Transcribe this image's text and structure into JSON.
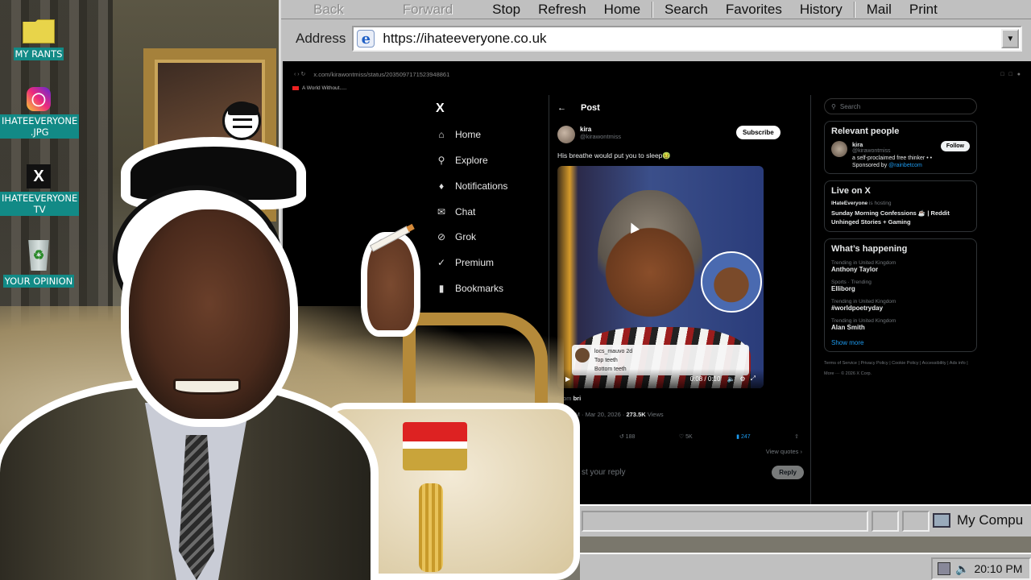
{
  "desktop": {
    "icons": [
      {
        "label": "MY RANTS",
        "icon": "folder-icon"
      },
      {
        "label": "IHATEEVERYONE .JPG",
        "icon": "instagram-icon"
      },
      {
        "label": "IHATEEVERYONE TV",
        "icon": "x-icon"
      },
      {
        "label": "YOUR OPINION",
        "icon": "recycle-bin-icon"
      }
    ]
  },
  "browser": {
    "toolbar": {
      "back": "Back",
      "forward": "Forward",
      "stop": "Stop",
      "refresh": "Refresh",
      "home": "Home",
      "search": "Search",
      "favorites": "Favorites",
      "history": "History",
      "mail": "Mail",
      "print": "Print"
    },
    "address_label": "Address",
    "address_value": "https://ihateeveryone.co.uk",
    "status": {
      "my_computer": "My Compu"
    }
  },
  "embedded": {
    "url": "x.com/kirawontmiss/status/2035097171523948861",
    "tab_hint": "A World Without.....",
    "nav": [
      {
        "label": "Home",
        "icon": "home-icon"
      },
      {
        "label": "Explore",
        "icon": "search-icon"
      },
      {
        "label": "Notifications",
        "icon": "bell-icon"
      },
      {
        "label": "Chat",
        "icon": "mail-icon"
      },
      {
        "label": "Grok",
        "icon": "grok-icon"
      },
      {
        "label": "Premium",
        "icon": "premium-icon"
      },
      {
        "label": "Bookmarks",
        "icon": "bookmark-icon"
      }
    ],
    "post": {
      "header": "Post",
      "author_name": "kira",
      "author_handle": "@kirawontmiss",
      "subscribe": "Subscribe",
      "text": "His breathe would put you to sleep🤢",
      "reply_user": "locs_mauvo",
      "reply_age": "2d",
      "reply_line1": "Top teeth",
      "reply_line2": "Bottom teeth",
      "video_time": "0:08 / 0:10",
      "from_label": "From",
      "from_user": "bri",
      "timestamp": "8:52 PM · Mar 20, 2026 ·",
      "views_count": "273.5K",
      "views_label": "Views",
      "replies": "137",
      "reposts": "188",
      "likes": "5K",
      "bookmarks": "247",
      "view_quotes": "View quotes ›",
      "reply_placeholder": "st your reply",
      "reply_button": "Reply"
    },
    "sidebar": {
      "search_placeholder": "Search",
      "relevant_title": "Relevant people",
      "rp_name": "kira",
      "rp_handle": "@kirawontmiss",
      "rp_bio": "a self-proclaimed free thinker • •",
      "rp_sponsored": "Sponsored by",
      "rp_sponsor_link": "@rainbetcom",
      "follow": "Follow",
      "live_title": "Live on X",
      "live_host": "IHateEveryone",
      "live_hosting": "is hosting",
      "live_show": "Sunday Morning Confessions ☕ | Reddit Unhinged Stories + Gaming",
      "happening_title": "What’s happening",
      "trends": [
        {
          "context": "Trending in United Kingdom",
          "topic": "Anthony Taylor"
        },
        {
          "context": "Sports · Trending",
          "topic": "Elliborg"
        },
        {
          "context": "Trending in United Kingdom",
          "topic": "#worldpoetryday"
        },
        {
          "context": "Trending in United Kingdom",
          "topic": "Alan Smith"
        }
      ],
      "show_more": "Show more",
      "footer": "Terms of Service | Privacy Policy | Cookie Policy | Accessibility | Ads info | More ··· © 2026 X Corp."
    }
  },
  "taskbar": {
    "clock": "20:10 PM"
  }
}
